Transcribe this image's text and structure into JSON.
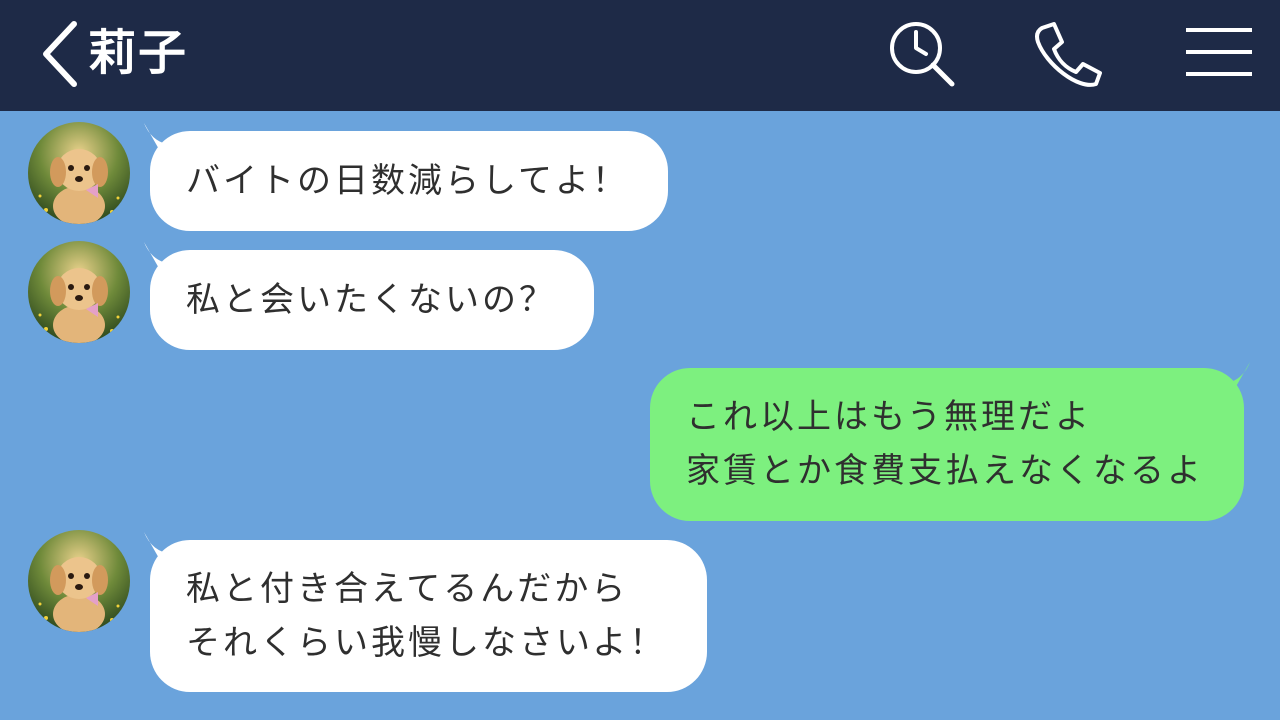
{
  "header": {
    "contact_name": "莉子",
    "icons": {
      "back": "chevron-left-icon",
      "search": "search-clock-icon",
      "call": "phone-icon",
      "menu": "hamburger-menu-icon"
    }
  },
  "colors": {
    "header_bg": "#1e2a47",
    "chat_bg": "#6aa3dc",
    "incoming_bubble": "#ffffff",
    "outgoing_bubble": "#7df07f",
    "text": "#2f2f2f"
  },
  "messages": [
    {
      "sender": "contact",
      "lines": [
        "バイトの日数減らしてよ！"
      ]
    },
    {
      "sender": "contact",
      "lines": [
        "私と会いたくないの？"
      ]
    },
    {
      "sender": "me",
      "lines": [
        "これ以上はもう無理だよ",
        "家賃とか食費支払えなくなるよ"
      ]
    },
    {
      "sender": "contact",
      "lines": [
        "私と付き合えてるんだから",
        "それくらい我慢しなさいよ！"
      ]
    }
  ]
}
